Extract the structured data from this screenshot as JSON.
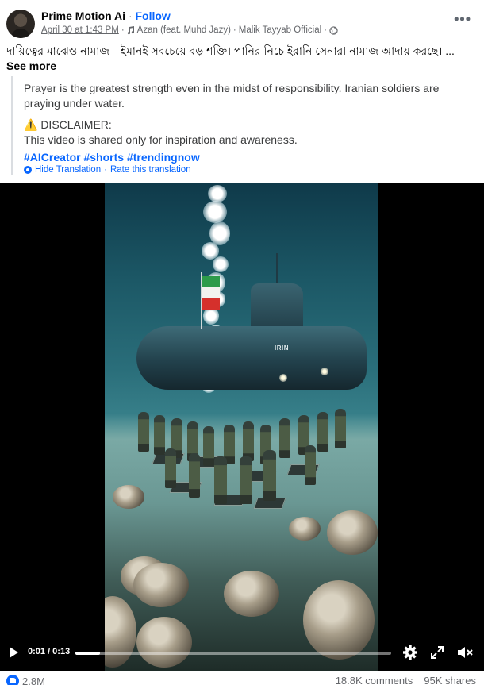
{
  "post": {
    "author": "Prime Motion Ai",
    "separator": "·",
    "follow_label": "Follow",
    "date": "April 30 at 1:43 PM",
    "meta_sep": "·",
    "audio": "Azan (feat. Muhd Jazy)",
    "meta_sep2": "·",
    "audio_artist": "Malik Tayyab Official",
    "meta_sep3": "·",
    "more_label": "•••",
    "caption_bn": "দায়িত্বের মাঝেও নামাজ—ইমানই সবচেয়ে বড় শক্তি।  পানির নিচে ইরানি সেনারা নামাজ আদায় করছে। ...",
    "see_more": "See more"
  },
  "translation": {
    "text": "Prayer is the greatest strength even in the midst of responsibility. Iranian soldiers are praying under water.",
    "disclaimer_title": "⚠️ DISCLAIMER:",
    "disclaimer_body": "This video is shared only for inspiration and awareness.",
    "hashtags": "#AICreator #shorts #trendingnow",
    "hide_label": "Hide Translation",
    "dot": "·",
    "rate_label": "Rate this translation"
  },
  "video": {
    "hull_text": "IRIN",
    "time": "0:01 / 0:13",
    "progress": 0.077
  },
  "stats": {
    "reactions": "2.8M",
    "comments": "18.8K comments",
    "shares": "95K shares"
  },
  "colors": {
    "accent": "#0866ff",
    "muted": "#65676b"
  }
}
